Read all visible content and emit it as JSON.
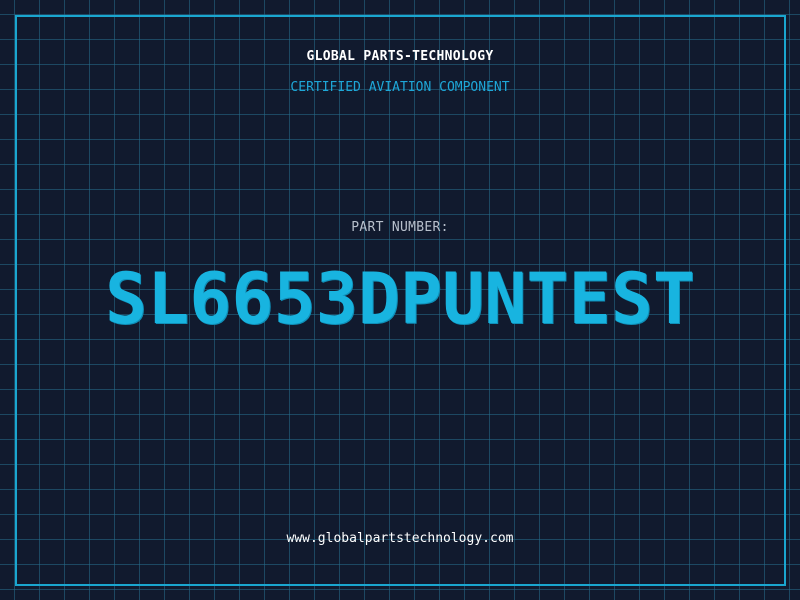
{
  "header": {
    "company": "GLOBAL PARTS-TECHNOLOGY",
    "subtitle": "CERTIFIED AVIATION COMPONENT"
  },
  "part": {
    "label": "PART NUMBER:",
    "number": "SL6653DPUNTEST"
  },
  "footer": {
    "website": "www.globalpartstechnology.com"
  },
  "colors": {
    "background": "#111a2e",
    "grid": "#266e8c",
    "frame": "#1aa6cf",
    "accent": "#18b4e0",
    "label": "#b8c0cc",
    "text": "#ffffff"
  }
}
